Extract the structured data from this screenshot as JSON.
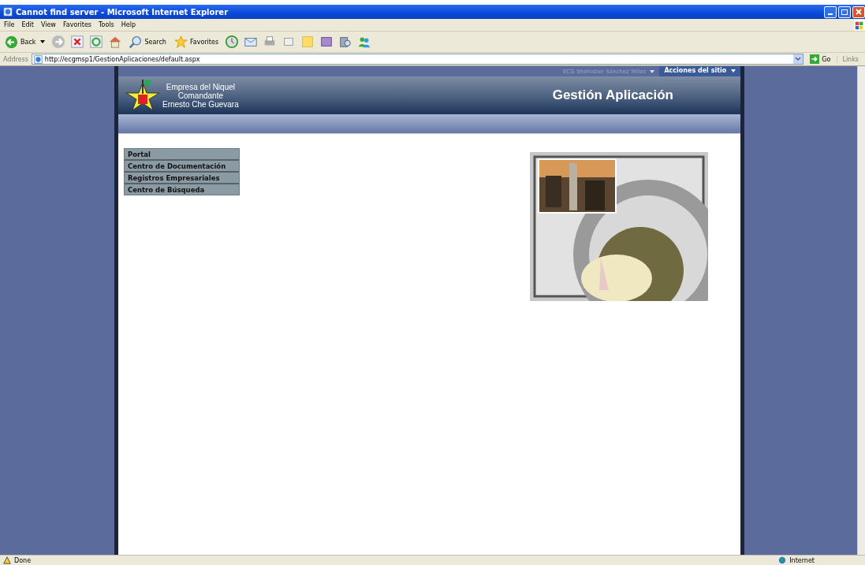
{
  "window": {
    "title": "Cannot find server - Microsoft Internet Explorer"
  },
  "menu": [
    "File",
    "Edit",
    "View",
    "Favorites",
    "Tools",
    "Help"
  ],
  "toolbar": {
    "back": "Back",
    "search": "Search",
    "favorites": "Favorites"
  },
  "address": {
    "label": "Address",
    "value": "http://ecgmsp1/GestionAplicaciones/default.aspx",
    "go": "Go",
    "links": "Links"
  },
  "site": {
    "user": "ECG Shehistier Sánchez Téllez",
    "actions": "Acciones del sitio",
    "org_lines": [
      "Empresa del Niquel",
      "Comandante",
      "Ernesto Che Guevara"
    ],
    "title": "Gestión Aplicación",
    "nav": [
      "Portal",
      "Centro de Documentación",
      "Registros Empresariales",
      "Centro de Búsqueda"
    ],
    "image": {
      "kind": "picture"
    }
  },
  "status_bar": {
    "text": "Done",
    "zone": "Internet"
  }
}
